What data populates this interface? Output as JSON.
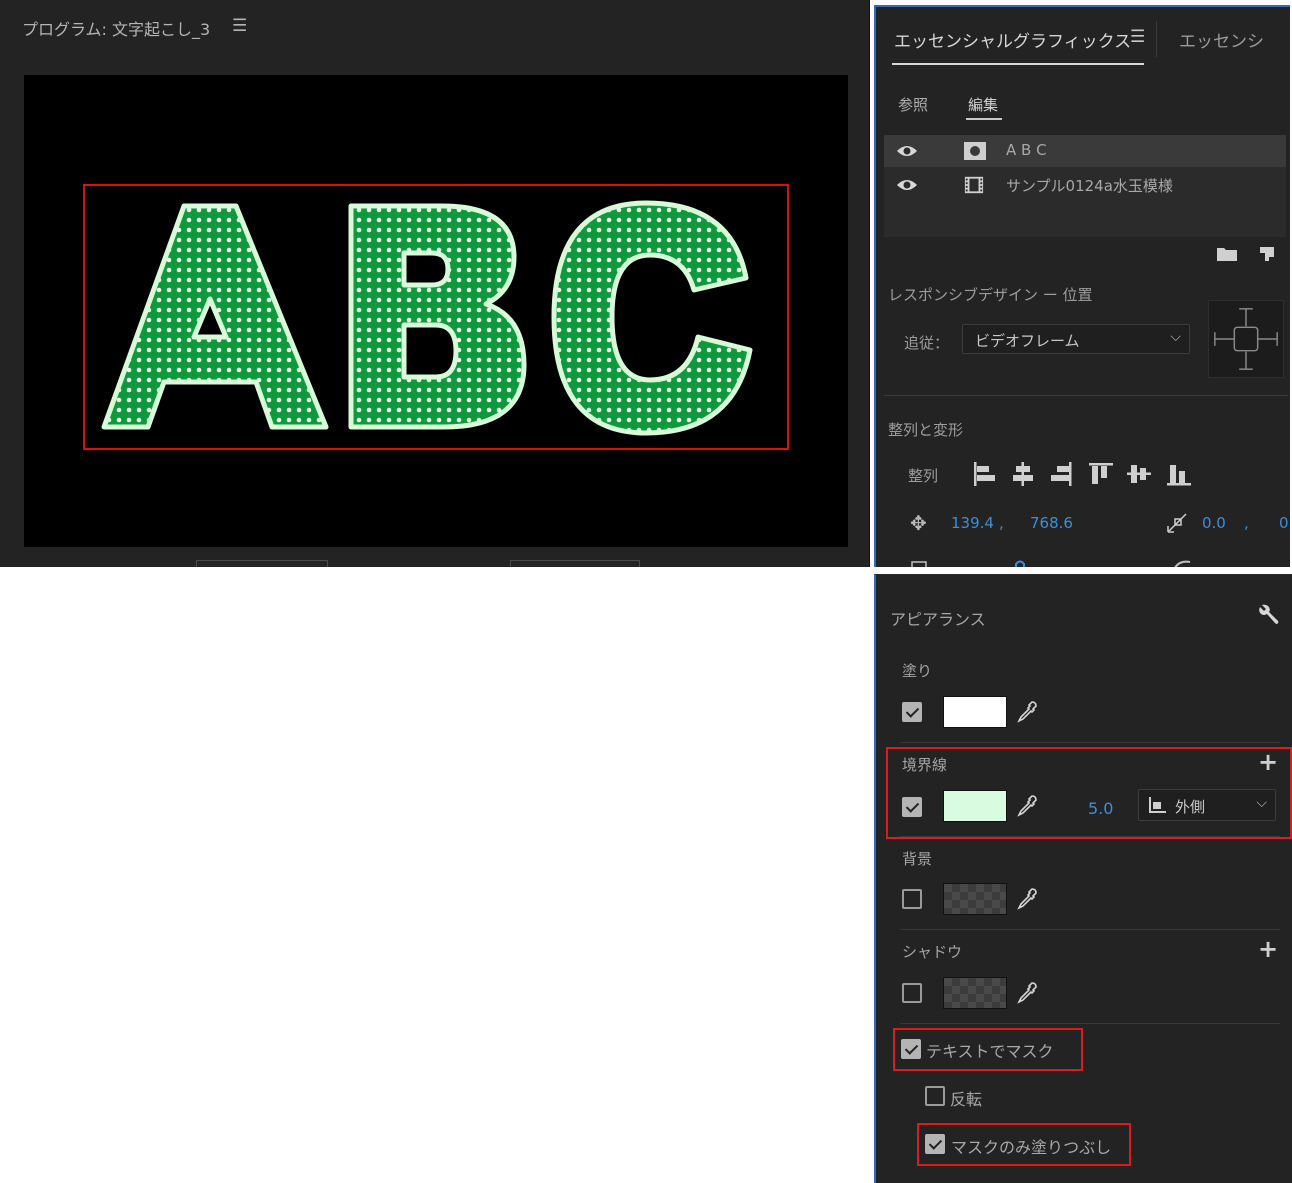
{
  "program_monitor": {
    "title": "プログラム: 文字起こし_3",
    "menu_icon": "hamburger-menu-icon",
    "preview_text": "ABC",
    "preview_colors": {
      "fill": "#0e9a3c",
      "dots": "#e9ffe9",
      "stroke": "#d7fad7",
      "background": "#000000",
      "selection": "#d11414"
    }
  },
  "essential_graphics": {
    "tab_label": "エッセンシャルグラフィックス",
    "tab2_label": "エッセンシ",
    "subtabs": {
      "browse": "参照",
      "edit": "編集"
    },
    "layers": [
      {
        "name": "A B C",
        "icon": "text-layer-icon",
        "visible": true
      },
      {
        "name": "サンプル0124a水玉模様",
        "icon": "film-clip-icon",
        "visible": true
      }
    ],
    "responsive_design": {
      "title": "レスポンシブデザイン ー 位置",
      "follow_label": "追従：",
      "follow_value": "ビデオフレーム"
    },
    "align_transform": {
      "title": "整列と変形",
      "align_label": "整列",
      "position_x": "139.4",
      "position_y": "768.6",
      "comma": ",",
      "anchor_x": "0.0",
      "anchor_y_cut": "0"
    }
  },
  "appearance": {
    "title": "アピアランス",
    "fill": {
      "label": "塗り",
      "checked": true,
      "color": "#ffffff"
    },
    "stroke": {
      "label": "境界線",
      "checked": true,
      "color": "#d9fbe0",
      "width": "5.0",
      "position": "外側"
    },
    "background": {
      "label": "背景",
      "checked": false
    },
    "shadow": {
      "label": "シャドウ",
      "checked": false
    },
    "mask_with_text": {
      "label": "テキストでマスク",
      "checked": true
    },
    "invert": {
      "label": "反転",
      "checked": false
    },
    "fill_mask_only": {
      "label": "マスクのみ塗りつぶし",
      "checked": true
    }
  },
  "colors": {
    "panel_bg": "#232323",
    "accent_blue": "#3b8fd9",
    "highlight_red": "#e0191b",
    "panel_border_blue": "#2d6bc4"
  }
}
